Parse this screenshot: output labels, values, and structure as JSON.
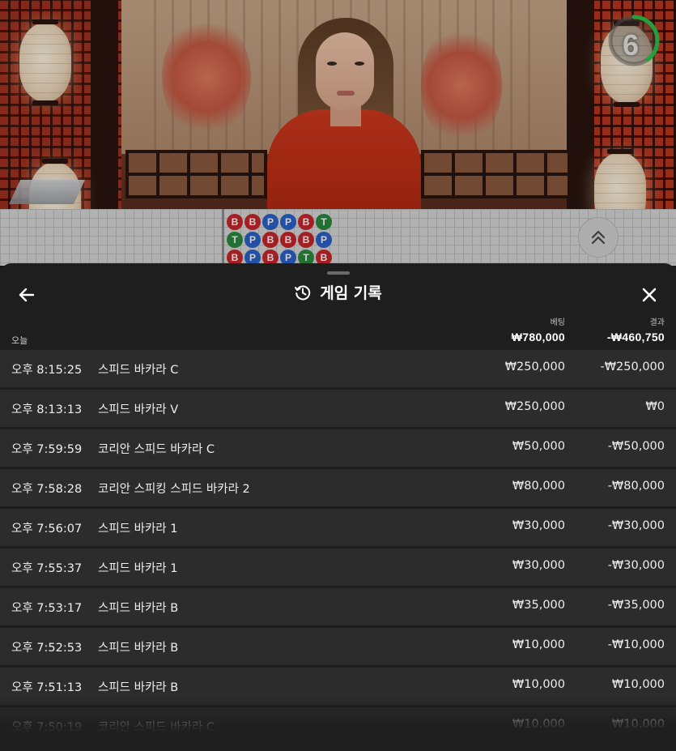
{
  "video": {
    "timer": {
      "value": "6",
      "progress": 0.4,
      "color": "#2ec14a"
    }
  },
  "roadmap": {
    "beads": [
      [
        "B",
        "T",
        "B"
      ],
      [
        "B",
        "P",
        "P"
      ],
      [
        "P",
        "B",
        "B"
      ],
      [
        "P",
        "B",
        "P"
      ],
      [
        "B",
        "B",
        "T"
      ],
      [
        "T",
        "P",
        "B"
      ]
    ],
    "colors": {
      "B": "#c8262b",
      "P": "#2a62c8",
      "T": "#2b8a3e"
    },
    "expand_icon": "double-chevron-up-icon"
  },
  "history": {
    "title": "게임 기록",
    "title_icon": "history-icon",
    "back_icon": "arrow-left-icon",
    "close_icon": "close-icon",
    "section_label": "오늘",
    "bet_header": "베팅",
    "result_header": "결과",
    "total_bet": "₩780,000",
    "total_result": "-₩460,750",
    "rows": [
      {
        "time": "오후 8:15:25",
        "game": "스피드 바카라 C",
        "bet": "₩250,000",
        "result": "-₩250,000"
      },
      {
        "time": "오후 8:13:13",
        "game": "스피드 바카라 V",
        "bet": "₩250,000",
        "result": "₩0"
      },
      {
        "time": "오후 7:59:59",
        "game": "코리안 스피드 바카라 C",
        "bet": "₩50,000",
        "result": "-₩50,000"
      },
      {
        "time": "오후 7:58:28",
        "game": "코리안 스피킹 스피드 바카라 2",
        "bet": "₩80,000",
        "result": "-₩80,000"
      },
      {
        "time": "오후 7:56:07",
        "game": "스피드 바카라 1",
        "bet": "₩30,000",
        "result": "-₩30,000"
      },
      {
        "time": "오후 7:55:37",
        "game": "스피드 바카라 1",
        "bet": "₩30,000",
        "result": "-₩30,000"
      },
      {
        "time": "오후 7:53:17",
        "game": "스피드 바카라 B",
        "bet": "₩35,000",
        "result": "-₩35,000"
      },
      {
        "time": "오후 7:52:53",
        "game": "스피드 바카라 B",
        "bet": "₩10,000",
        "result": "-₩10,000"
      },
      {
        "time": "오후 7:51:13",
        "game": "스피드 바카라 B",
        "bet": "₩10,000",
        "result": "₩10,000"
      },
      {
        "time": "오후 7:50:19",
        "game": "코리안 스피드 바카라 C",
        "bet": "₩10,000",
        "result": "₩10,000"
      }
    ]
  }
}
